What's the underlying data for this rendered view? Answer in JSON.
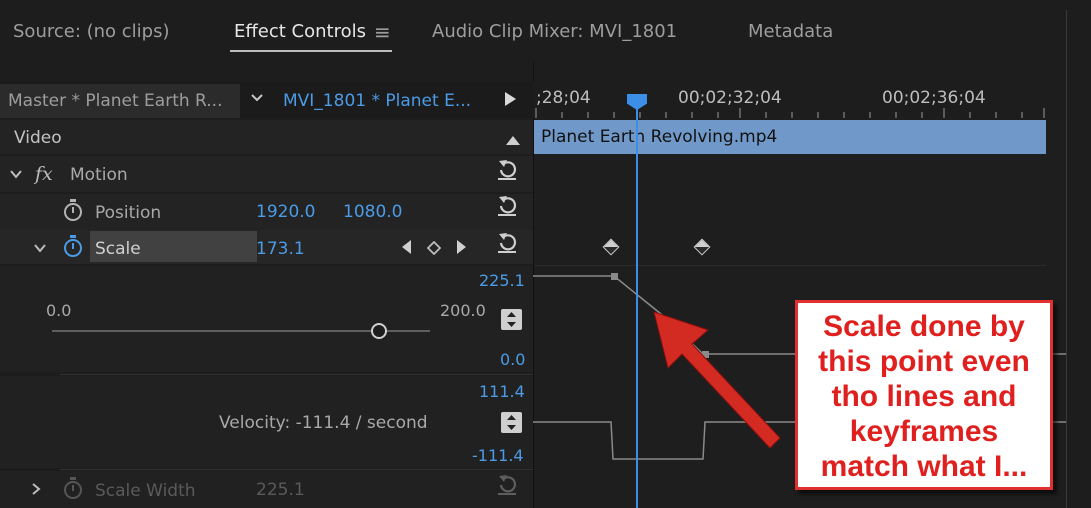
{
  "tabs": {
    "source": "Source: (no clips)",
    "effect_controls": "Effect Controls",
    "menu_icon": "≡",
    "audio_clip_mixer": "Audio Clip Mixer: MVI_1801",
    "metadata": "Metadata"
  },
  "clip_header": {
    "master": "Master * Planet Earth R...",
    "clip": "MVI_1801 * Planet E...",
    "play_icon": "▶"
  },
  "sections": {
    "video": "Video",
    "fx": "fx",
    "motion": "Motion"
  },
  "position": {
    "label": "Position",
    "x": "1920.0",
    "y": "1080.0"
  },
  "scale": {
    "label": "Scale",
    "value": "173.1",
    "value_max": "225.1",
    "slider_min": "0.0",
    "slider_max": "200.0",
    "slider_fraction": 0.865,
    "value_min": "0.0",
    "velocity_max": "111.4",
    "velocity": "Velocity: -111.4 / second",
    "velocity_min": "-111.4"
  },
  "scale_width": {
    "label": "Scale Width",
    "value": "225.1"
  },
  "timeline": {
    "time_left": ";28;04",
    "time_mid": "00;02;32;04",
    "time_right": "00;02;36;04",
    "clip_name": "Planet Earth Revolving.mp4"
  },
  "annotation": {
    "lines": [
      "Scale done by",
      "this point even",
      "tho lines and",
      "keyframes",
      "match what I..."
    ]
  },
  "colors": {
    "accent_blue": "#4b9be6",
    "clip_bar": "#7099c9",
    "annotation_red": "#e0201f"
  }
}
